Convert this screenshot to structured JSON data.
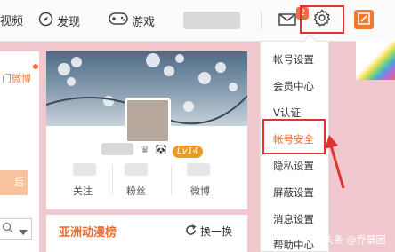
{
  "nav": {
    "video_fragment": "视频",
    "discover_label": "发现",
    "game_label": "游戏"
  },
  "notifications": {
    "mail_badge": "2"
  },
  "left_panel": {
    "link_fragment": "门微博",
    "orange_btn_fragment": "后"
  },
  "profile": {
    "level_badge": "Lv14",
    "stats": [
      {
        "label": "关注"
      },
      {
        "label": "粉丝"
      },
      {
        "label": "微博"
      }
    ]
  },
  "anime": {
    "title": "亚洲动漫榜",
    "refresh_label": "换一换"
  },
  "settings_menu": {
    "items": [
      {
        "label": "帐号设置"
      },
      {
        "label": "会员中心"
      },
      {
        "label": "V认证"
      },
      {
        "label": "帐号安全"
      },
      {
        "label": "隐私设置"
      },
      {
        "label": "屏蔽设置"
      },
      {
        "label": "消息设置"
      },
      {
        "label": "帮助中心"
      }
    ],
    "highlighted_index": 3
  },
  "watermark": "头条 @乔景团",
  "colors": {
    "accent_orange": "#ea7f39",
    "highlight_red": "#e0322f",
    "background_pink": "#f2c8cf"
  }
}
